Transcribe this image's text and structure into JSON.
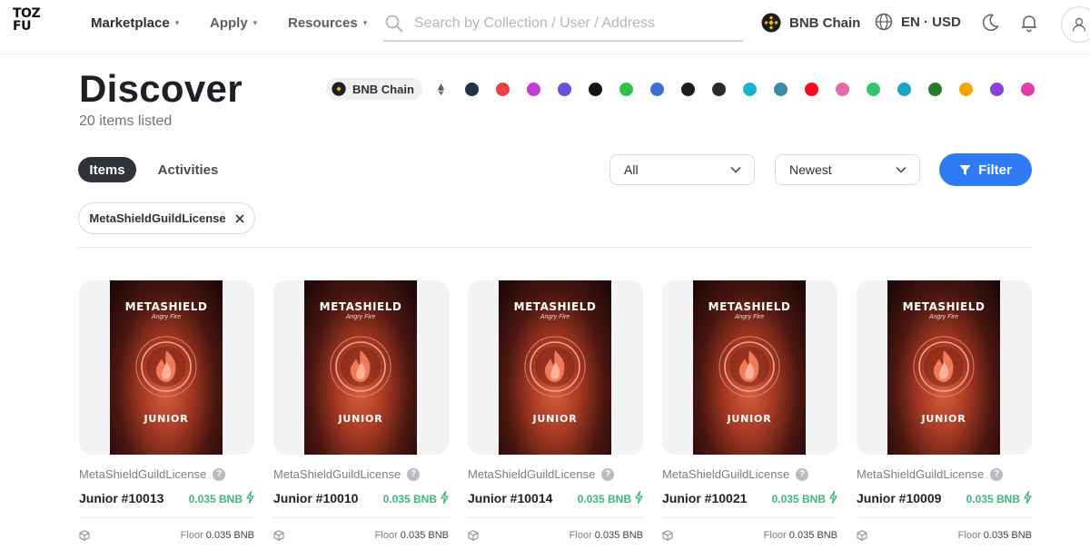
{
  "header": {
    "logo_line1": "TOZ",
    "logo_line2": "FU",
    "nav": [
      {
        "label": "Marketplace"
      },
      {
        "label": "Apply"
      },
      {
        "label": "Resources"
      }
    ],
    "search_placeholder": "Search by Collection / User / Address",
    "chain_label": "BNB Chain",
    "lang_label": "EN · USD"
  },
  "page": {
    "title": "Discover",
    "subtitle": "20 items listed",
    "selected_chain": "BNB Chain",
    "chain_icons": [
      {
        "name": "ethereum-icon",
        "color": "#5a5f66"
      },
      {
        "name": "arbitrum-icon",
        "color": "#213147"
      },
      {
        "name": "avalanche-icon",
        "color": "#e84142"
      },
      {
        "name": "chainlink-icon",
        "color": "#c33cd1"
      },
      {
        "name": "polygon-icon",
        "color": "#6c4be0"
      },
      {
        "name": "linea-icon",
        "color": "#121212"
      },
      {
        "name": "zksync-icon",
        "color": "#2ec24c"
      },
      {
        "name": "manta-icon",
        "color": "#3d6fd8"
      },
      {
        "name": "core-icon",
        "color": "#1c1c1c"
      },
      {
        "name": "kava-icon",
        "color": "#2a2a2a"
      },
      {
        "name": "scroll-icon",
        "color": "#18b4c9"
      },
      {
        "name": "sei-icon",
        "color": "#3a8aa8"
      },
      {
        "name": "optimism-icon",
        "color": "#ff0420"
      },
      {
        "name": "blast-icon",
        "color": "#e56aa8"
      },
      {
        "name": "celo-icon",
        "color": "#35c66b"
      },
      {
        "name": "mantle-icon",
        "color": "#1aa6c8"
      },
      {
        "name": "zeta-icon",
        "color": "#2a7a2a"
      },
      {
        "name": "moonbeam-icon",
        "color": "#f4a600"
      },
      {
        "name": "purple-chain-icon",
        "color": "#8a3fd8"
      },
      {
        "name": "pink-chain-icon",
        "color": "#e23fa7"
      }
    ],
    "tabs": {
      "items": "Items",
      "activities": "Activities"
    },
    "type_select": "All",
    "sort_select": "Newest",
    "filter_label": "Filter",
    "active_filter": "MetaShieldGuildLicense"
  },
  "cards": [
    {
      "collection": "MetaShieldGuildLicense",
      "name": "Junior #10013",
      "price": "0.035 BNB",
      "floor_label": "Floor",
      "floor_value": "0.035 BNB",
      "art_title": "METASHIELD",
      "art_sub": "Angry Fire",
      "art_tier": "JUNIOR"
    },
    {
      "collection": "MetaShieldGuildLicense",
      "name": "Junior #10010",
      "price": "0.035 BNB",
      "floor_label": "Floor",
      "floor_value": "0.035 BNB",
      "art_title": "METASHIELD",
      "art_sub": "Angry Fire",
      "art_tier": "JUNIOR"
    },
    {
      "collection": "MetaShieldGuildLicense",
      "name": "Junior #10014",
      "price": "0.035 BNB",
      "floor_label": "Floor",
      "floor_value": "0.035 BNB",
      "art_title": "METASHIELD",
      "art_sub": "Angry Fire",
      "art_tier": "JUNIOR"
    },
    {
      "collection": "MetaShieldGuildLicense",
      "name": "Junior #10021",
      "price": "0.035 BNB",
      "floor_label": "Floor",
      "floor_value": "0.035 BNB",
      "art_title": "METASHIELD",
      "art_sub": "Angry Fire",
      "art_tier": "JUNIOR"
    },
    {
      "collection": "MetaShieldGuildLicense",
      "name": "Junior #10009",
      "price": "0.035 BNB",
      "floor_label": "Floor",
      "floor_value": "0.035 BNB",
      "art_title": "METASHIELD",
      "art_sub": "Angry Fire",
      "art_tier": "JUNIOR"
    }
  ],
  "colors": {
    "accent": "#2f7bf5",
    "price_green": "#3fb67b",
    "bnb_yellow": "#f0b90b"
  }
}
